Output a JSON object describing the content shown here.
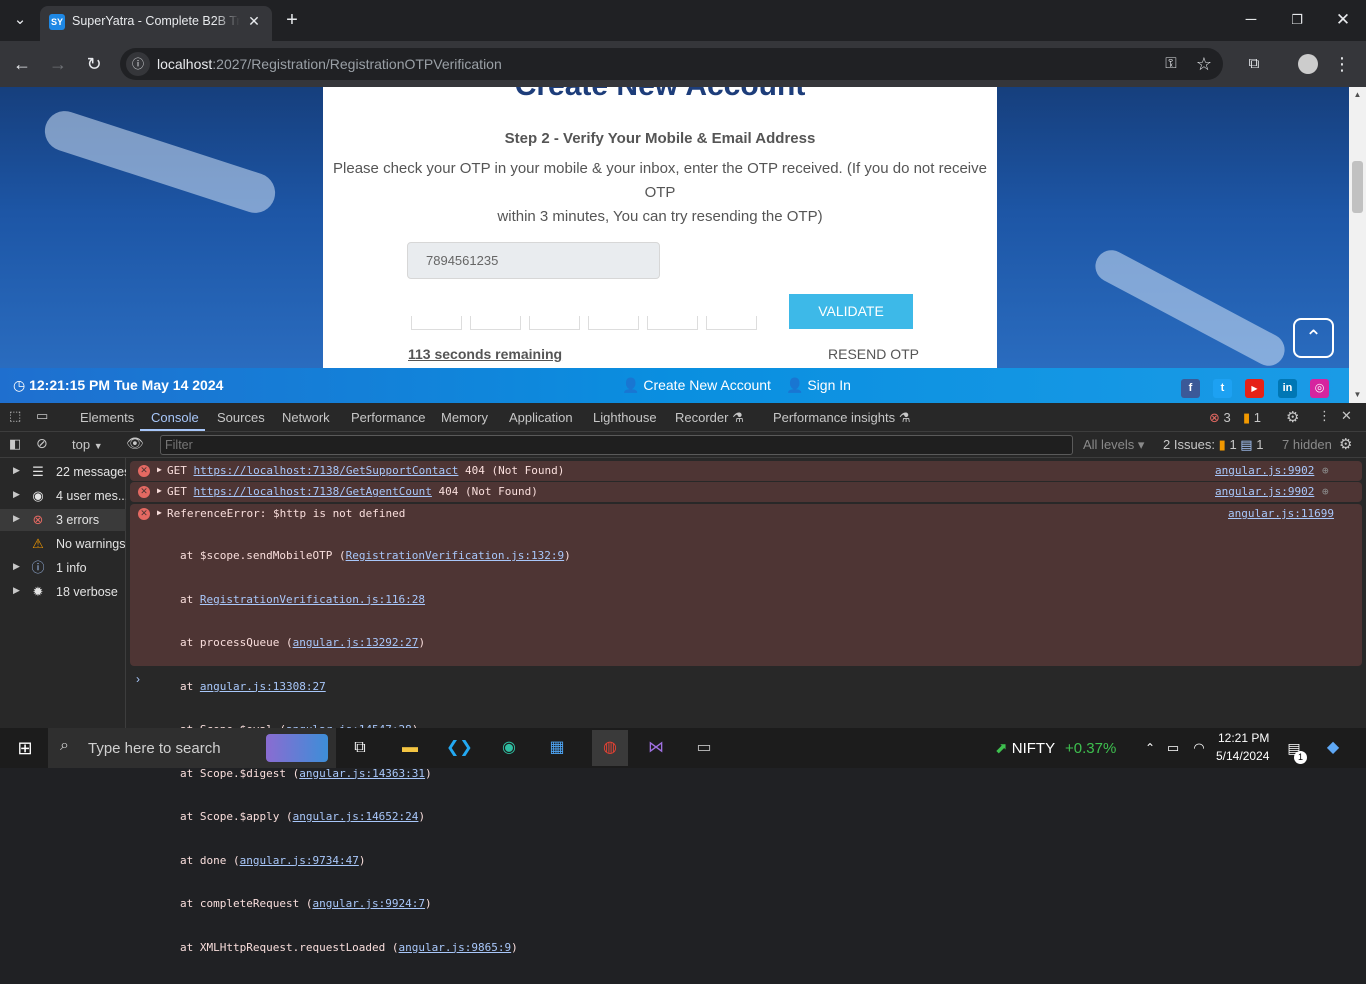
{
  "browser": {
    "tab_title": "SuperYatra - Complete B2B Trav",
    "tab_favicon": "SY",
    "url_host": "localhost",
    "url_rest": ":2027/Registration/RegistrationOTPVerification"
  },
  "page": {
    "heading": "Create New Account",
    "step": "Step 2 - Verify Your Mobile & Email Address",
    "info_line1": "Please check your OTP in your mobile & your inbox, enter the OTP received. (If you do not receive OTP",
    "info_line2": "within 3 minutes, You can try resending the OTP)",
    "phone_value": "7894561235",
    "validate_label": "VALIDATE",
    "timer": "113 seconds remaining",
    "resend_label": "RESEND OTP",
    "footer_clock": "12:21:15 PM Tue May 14 2024",
    "footer_new_account": "Create New Account",
    "footer_sign_in": "Sign In",
    "accent_color": "#3db9e8"
  },
  "devtools": {
    "tabs": [
      "Elements",
      "Console",
      "Sources",
      "Network",
      "Performance",
      "Memory",
      "Application",
      "Lighthouse",
      "Recorder ⚗",
      "Performance insights ⚗"
    ],
    "error_count": "3",
    "warning_count": "1",
    "context": "top",
    "filter_placeholder": "Filter",
    "levels": "All levels",
    "issues_label": "2 Issues:",
    "issues_errors": "1",
    "issues_info": "1",
    "hidden": "7 hidden",
    "sidebar": [
      {
        "label": "22 messages",
        "icon": "list-icon"
      },
      {
        "label": "4 user mes...",
        "icon": "user-icon"
      },
      {
        "label": "3 errors",
        "icon": "error-icon"
      },
      {
        "label": "No warnings",
        "icon": "warning-icon"
      },
      {
        "label": "1 info",
        "icon": "info-icon"
      },
      {
        "label": "18 verbose",
        "icon": "bug-icon"
      }
    ],
    "messages": [
      {
        "method": "GET",
        "url": "https://localhost:7138/GetSupportContact",
        "status": "404 (Not Found)",
        "source": "angular.js:9902"
      },
      {
        "method": "GET",
        "url": "https://localhost:7138/GetAgentCount",
        "status": "404 (Not Found)",
        "source": "angular.js:9902"
      }
    ],
    "exception": {
      "message": "ReferenceError: $http is not defined",
      "source": "angular.js:11699",
      "stack": [
        {
          "pre": "at $scope.sendMobileOTP (",
          "link": "RegistrationVerification.js:132:9",
          "post": ")"
        },
        {
          "pre": "at ",
          "link": "RegistrationVerification.js:116:28",
          "post": ""
        },
        {
          "pre": "at processQueue (",
          "link": "angular.js:13292:27",
          "post": ")"
        },
        {
          "pre": "at ",
          "link": "angular.js:13308:27",
          "post": ""
        },
        {
          "pre": "at Scope.$eval (",
          "link": "angular.js:14547:28",
          "post": ")"
        },
        {
          "pre": "at Scope.$digest (",
          "link": "angular.js:14363:31",
          "post": ")"
        },
        {
          "pre": "at Scope.$apply (",
          "link": "angular.js:14652:24",
          "post": ")"
        },
        {
          "pre": "at done (",
          "link": "angular.js:9734:47",
          "post": ")"
        },
        {
          "pre": "at completeRequest (",
          "link": "angular.js:9924:7",
          "post": ")"
        },
        {
          "pre": "at XMLHttpRequest.requestLoaded (",
          "link": "angular.js:9865:9",
          "post": ")"
        }
      ]
    }
  },
  "taskbar": {
    "search_placeholder": "Type here to search",
    "stock_name": "NIFTY",
    "stock_change": "+0.37%",
    "time": "12:21 PM",
    "date": "5/14/2024",
    "notification_count": "1"
  }
}
